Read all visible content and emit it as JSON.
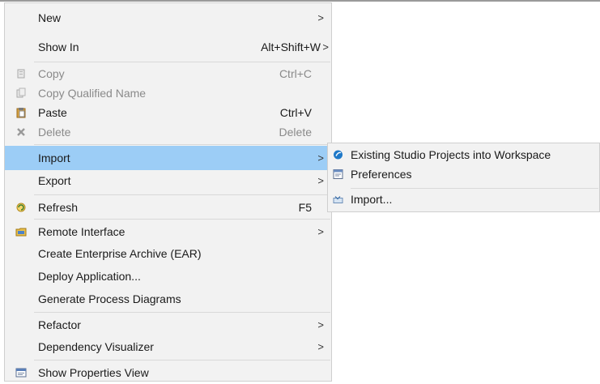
{
  "context_menu": {
    "items": [
      {
        "label": "New",
        "accel": "",
        "submenu": true
      },
      {
        "label": "Show In",
        "accel": "Alt+Shift+W",
        "submenu": true
      },
      {
        "label": "Copy",
        "accel": "Ctrl+C",
        "icon": "copy-icon",
        "disabled": true
      },
      {
        "label": "Copy Qualified Name",
        "accel": "",
        "icon": "copy-qualified-name-icon",
        "disabled": true
      },
      {
        "label": "Paste",
        "accel": "Ctrl+V",
        "icon": "paste-icon"
      },
      {
        "label": "Delete",
        "accel": "Delete",
        "icon": "delete-icon",
        "disabled": true
      },
      {
        "label": "Import",
        "accel": "",
        "submenu": true,
        "active": true
      },
      {
        "label": "Export",
        "accel": "",
        "submenu": true
      },
      {
        "label": "Refresh",
        "accel": "F5",
        "icon": "refresh-icon"
      },
      {
        "label": "Remote Interface",
        "accel": "",
        "icon": "remote-interface-icon",
        "submenu": true
      },
      {
        "label": "Create Enterprise Archive (EAR)",
        "accel": ""
      },
      {
        "label": "Deploy Application...",
        "accel": ""
      },
      {
        "label": "Generate Process Diagrams",
        "accel": ""
      },
      {
        "label": "Refactor",
        "accel": "",
        "submenu": true
      },
      {
        "label": "Dependency Visualizer",
        "accel": "",
        "submenu": true
      },
      {
        "label": "Show Properties View",
        "accel": "",
        "icon": "properties-view-icon"
      }
    ],
    "arrow_glyph": ">"
  },
  "import_submenu": {
    "items": [
      {
        "label": "Existing Studio Projects into Workspace",
        "icon": "studio-project-icon"
      },
      {
        "label": "Preferences",
        "icon": "preferences-icon"
      },
      {
        "label": "Import...",
        "icon": "import-wizard-icon"
      }
    ]
  },
  "colors": {
    "menu_background": "#f2f2f2",
    "active_highlight": "#9ccdf6",
    "disabled_text": "#8a8a8a"
  }
}
